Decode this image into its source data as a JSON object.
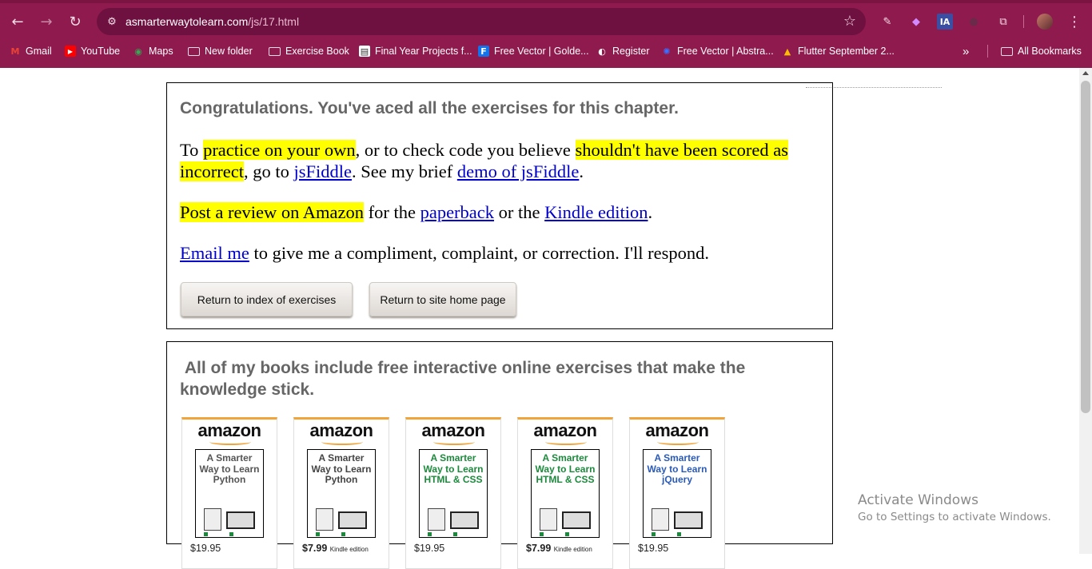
{
  "browser": {
    "url_host": "asmarterwaytolearn.com",
    "url_path": "/js/17.html",
    "icons": {
      "back": "←",
      "forward": "→",
      "reload": "↻",
      "site_info": "⚙",
      "star": "☆",
      "eyedropper": "✎",
      "ia": "IA",
      "puzzle": "⧉",
      "menu": "⋮",
      "more": "»"
    },
    "bookmarks": [
      {
        "label": "Gmail",
        "icon": "M"
      },
      {
        "label": "YouTube",
        "icon": "▶"
      },
      {
        "label": "Maps",
        "icon": "◉"
      },
      {
        "label": "New folder"
      },
      {
        "label": "Exercise Book"
      },
      {
        "label": "Final Year Projects f...",
        "icon": "▤"
      },
      {
        "label": "Free Vector | Golde...",
        "icon": "F"
      },
      {
        "label": "Register",
        "icon": "◐"
      },
      {
        "label": "Free Vector | Abstra...",
        "icon": "✺"
      },
      {
        "label": "Flutter September 2...",
        "icon": "▲"
      }
    ],
    "all_bookmarks": "All Bookmarks"
  },
  "content": {
    "congrats": "Congratulations. You've aced all the exercises for this chapter.",
    "p1": {
      "t1": "To ",
      "h1": "practice on your own",
      "t2": ", or to check code you believe ",
      "h2": "shouldn't have been scored as incorrect",
      "t3": ", go to ",
      "l1": "jsFiddle",
      "t4": ". See my brief ",
      "l2": "demo of jsFiddle",
      "t5": "."
    },
    "p2": {
      "h1": "Post a review on Amazon",
      "t1": " for the ",
      "l1": "paperback",
      "t2": " or the ",
      "l2": "Kindle edition",
      "t3": "."
    },
    "p3": {
      "l1": "Email me",
      "t1": " to give me a compliment, complaint, or correction. I'll respond."
    },
    "btn_index": "Return to index of exercises",
    "btn_home": "Return to site home page",
    "books_title": "All of my books include free interactive online exercises that make the knowledge stick."
  },
  "books": [
    {
      "amazon": "amazon",
      "title": "A Smarter Way to Learn Python",
      "color": "#555555",
      "price": "$19.95",
      "edition": ""
    },
    {
      "amazon": "amazon",
      "title": "A Smarter Way to Learn Python",
      "color": "#444444",
      "price": "$7.99",
      "edition": "Kindle edition"
    },
    {
      "amazon": "amazon",
      "title": "A Smarter Way to Learn HTML & CSS",
      "color": "#1c8a3c",
      "price": "$19.95",
      "edition": ""
    },
    {
      "amazon": "amazon",
      "title": "A Smarter Way to Learn HTML & CSS",
      "color": "#1c8a3c",
      "price": "$7.99",
      "edition": "Kindle edition"
    },
    {
      "amazon": "amazon",
      "title": "A Smarter Way to Learn jQuery",
      "color": "#2a5ab8",
      "price": "$19.95",
      "edition": ""
    }
  ],
  "watermark": {
    "line1": "Activate Windows",
    "line2": "Go to Settings to activate Windows."
  }
}
